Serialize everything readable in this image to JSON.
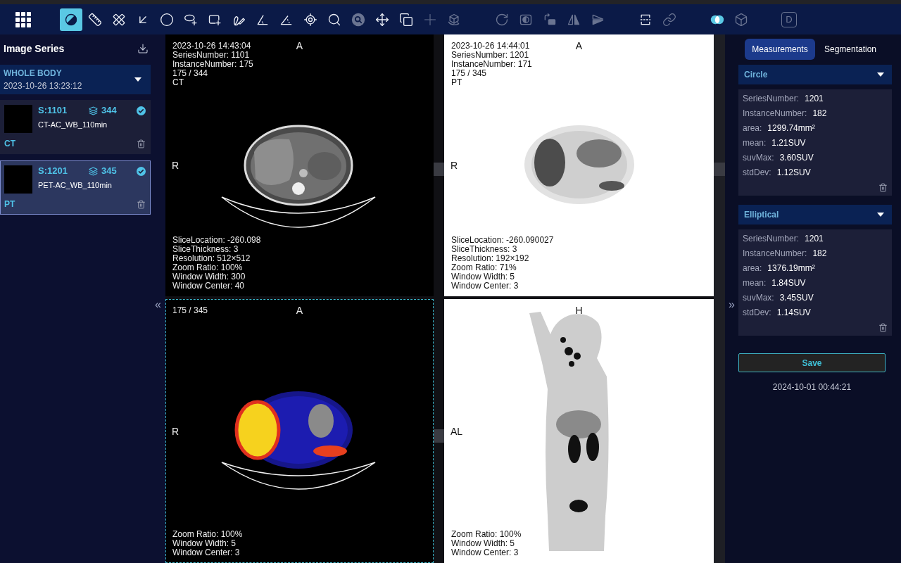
{
  "toolbar": {
    "groups": [
      {
        "tools": [
          {
            "selected": true,
            "disabled": false,
            "on": false
          },
          {
            "selected": false,
            "disabled": false,
            "on": false
          },
          {
            "selected": false,
            "disabled": false,
            "on": false
          },
          {
            "selected": false,
            "disabled": false,
            "on": false
          },
          {
            "selected": false,
            "disabled": false,
            "on": false
          },
          {
            "selected": false,
            "disabled": false,
            "on": false
          },
          {
            "selected": false,
            "disabled": false,
            "on": false
          },
          {
            "selected": false,
            "disabled": false,
            "on": false
          },
          {
            "selected": false,
            "disabled": false,
            "on": false
          },
          {
            "selected": false,
            "disabled": false,
            "on": false
          },
          {
            "selected": false,
            "disabled": false,
            "on": false
          },
          {
            "selected": false,
            "disabled": false,
            "on": false
          },
          {
            "selected": false,
            "disabled": true,
            "on": false
          },
          {
            "selected": false,
            "disabled": false,
            "on": false
          },
          {
            "selected": false,
            "disabled": false,
            "on": false
          },
          {
            "selected": false,
            "disabled": true,
            "on": false
          },
          {
            "selected": false,
            "disabled": true,
            "on": false
          }
        ]
      },
      {
        "tools": [
          {
            "selected": false,
            "disabled": true,
            "on": false
          },
          {
            "selected": false,
            "disabled": true,
            "on": false
          },
          {
            "selected": false,
            "disabled": true,
            "on": false
          },
          {
            "selected": false,
            "disabled": true,
            "on": false
          },
          {
            "selected": false,
            "disabled": true,
            "on": false
          }
        ]
      },
      {
        "tools": [
          {
            "selected": false,
            "disabled": false,
            "on": false
          },
          {
            "selected": false,
            "disabled": true,
            "on": false
          }
        ]
      },
      {
        "tools": [
          {
            "selected": false,
            "disabled": false,
            "on": true
          },
          {
            "selected": false,
            "disabled": true,
            "on": false
          }
        ]
      },
      {
        "tools": [
          {
            "label": "D",
            "selected": false,
            "disabled": true,
            "on": false
          }
        ]
      }
    ]
  },
  "sidebar": {
    "title": "Image Series",
    "study": {
      "name": "WHOLE BODY",
      "date": "2023-10-26 13:23:12"
    },
    "series": [
      {
        "number": "S:1101",
        "count": "344",
        "description": "CT-AC_WB_110min",
        "modality": "CT",
        "checked": true,
        "selected": false
      },
      {
        "number": "S:1201",
        "count": "345",
        "description": "PET-AC_WB_110min",
        "modality": "PT",
        "checked": true,
        "selected": true
      }
    ]
  },
  "left_toggle": "«",
  "viewports": [
    {
      "kind": "ct",
      "selected": false,
      "top_info": [
        "2023-10-26 14:43:04",
        "SeriesNumber: 1101",
        "InstanceNumber: 175",
        "175 / 344",
        "CT"
      ],
      "top_marker": "A",
      "left_marker": "R",
      "bottom_info": [
        "SliceLocation: -260.098",
        "SliceThickness: 3",
        "Resolution: 512×512",
        "Zoom Ratio: 100%",
        "Window Width: 300",
        "Window Center: 40"
      ]
    },
    {
      "kind": "pet",
      "selected": false,
      "top_info": [
        "2023-10-26 14:44:01",
        "SeriesNumber: 1201",
        "InstanceNumber: 171",
        "175 / 345",
        "PT"
      ],
      "top_marker": "A",
      "left_marker": "R",
      "bottom_info": [
        "SliceLocation: -260.090027",
        "SliceThickness: 3",
        "Resolution: 192×192",
        "Zoom Ratio: 71%",
        "Window Width: 5",
        "Window Center: 3"
      ]
    },
    {
      "kind": "fusion",
      "selected": true,
      "top_info": [
        "175 / 345"
      ],
      "top_marker": "A",
      "left_marker": "R",
      "bottom_info": [
        "Zoom Ratio: 100%",
        "Window Width: 5",
        "Window Center: 3"
      ]
    },
    {
      "kind": "mip",
      "selected": false,
      "top_marker": "H",
      "left_marker": "AL",
      "bottom_info": [
        "Zoom Ratio: 100%",
        "Window Width: 5",
        "Window Center: 3"
      ]
    }
  ],
  "right_toggle": "»",
  "right_panel": {
    "tabs": [
      {
        "label": "Measurements",
        "selected": true
      },
      {
        "label": "Segmentation",
        "selected": false
      }
    ],
    "measurements": [
      {
        "title": "Circle",
        "rows": [
          {
            "label": "SeriesNumber:",
            "value": "1201"
          },
          {
            "label": "InstanceNumber:",
            "value": "182"
          },
          {
            "label": "area:",
            "value": "1299.74mm²"
          },
          {
            "label": "mean:",
            "value": "1.21SUV"
          },
          {
            "label": "suvMax:",
            "value": "3.60SUV"
          },
          {
            "label": "stdDev:",
            "value": "1.12SUV"
          }
        ]
      },
      {
        "title": "Elliptical",
        "rows": [
          {
            "label": "SeriesNumber:",
            "value": "1201"
          },
          {
            "label": "InstanceNumber:",
            "value": "182"
          },
          {
            "label": "area:",
            "value": "1376.19mm²"
          },
          {
            "label": "mean:",
            "value": "1.84SUV"
          },
          {
            "label": "suvMax:",
            "value": "3.45SUV"
          },
          {
            "label": "stdDev:",
            "value": "1.14SUV"
          }
        ]
      }
    ],
    "save_button": "Save",
    "saved_at": "2024-10-01 00:44:21"
  }
}
